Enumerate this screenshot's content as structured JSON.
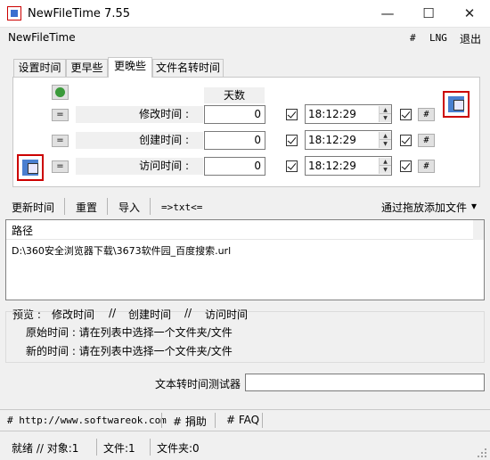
{
  "window": {
    "title": "NewFileTime 7.55",
    "minimize": "—",
    "maximize": "☐",
    "close": "✕"
  },
  "menu": {
    "app_name": "NewFileTime",
    "hash": "#",
    "lng": "LNG",
    "exit": "退出"
  },
  "tabs": [
    {
      "label": "设置时间",
      "active": false
    },
    {
      "label": "更早些",
      "active": false
    },
    {
      "label": "更晚些",
      "active": true
    },
    {
      "label": "文件名转时间",
      "active": false
    }
  ],
  "panel": {
    "days_header": "天数",
    "rows": [
      {
        "eq": "=",
        "label": "修改时间 :",
        "days": "0",
        "time": "18:12:29",
        "hash": "#",
        "time_checked": true,
        "enabled_checked": true
      },
      {
        "eq": "=",
        "label": "创建时间 :",
        "days": "0",
        "time": "18:12:29",
        "hash": "#",
        "time_checked": true,
        "enabled_checked": true
      },
      {
        "eq": "=",
        "label": "访问时间 :",
        "days": "0",
        "time": "18:12:29",
        "hash": "#",
        "time_checked": true,
        "enabled_checked": true
      }
    ]
  },
  "toolbar": {
    "update_time": "更新时间",
    "reset": "重置",
    "import": "导入",
    "txt": "=>txt<=",
    "drag_add": "通过拖放添加文件",
    "drag_arrow": "▾"
  },
  "list": {
    "header": "路径",
    "items": [
      "D:\\360安全浏览器下载\\3673软件园_百度搜索.url"
    ]
  },
  "preview": {
    "label": "预览 :",
    "modify": "修改时间",
    "sep1": "//",
    "create": "创建时间",
    "sep2": "//",
    "access": "访问时间",
    "original": "原始时间 : 请在列表中选择一个文件夹/文件",
    "new": "新的时间 : 请在列表中选择一个文件夹/文件"
  },
  "tester": {
    "label": "文本转时间测试器",
    "value": ""
  },
  "footer": {
    "website": "# http://www.softwareok.com",
    "donate": "# 捐助",
    "faq": "# FAQ"
  },
  "status": {
    "ready": "就绪 // 对象:1",
    "files": "文件:1",
    "folders": "文件夹:0"
  },
  "colors": {
    "icon_border": "#cc0000",
    "icon_fill": "#4a7fd0",
    "accent_green": "#3a9a3a"
  }
}
